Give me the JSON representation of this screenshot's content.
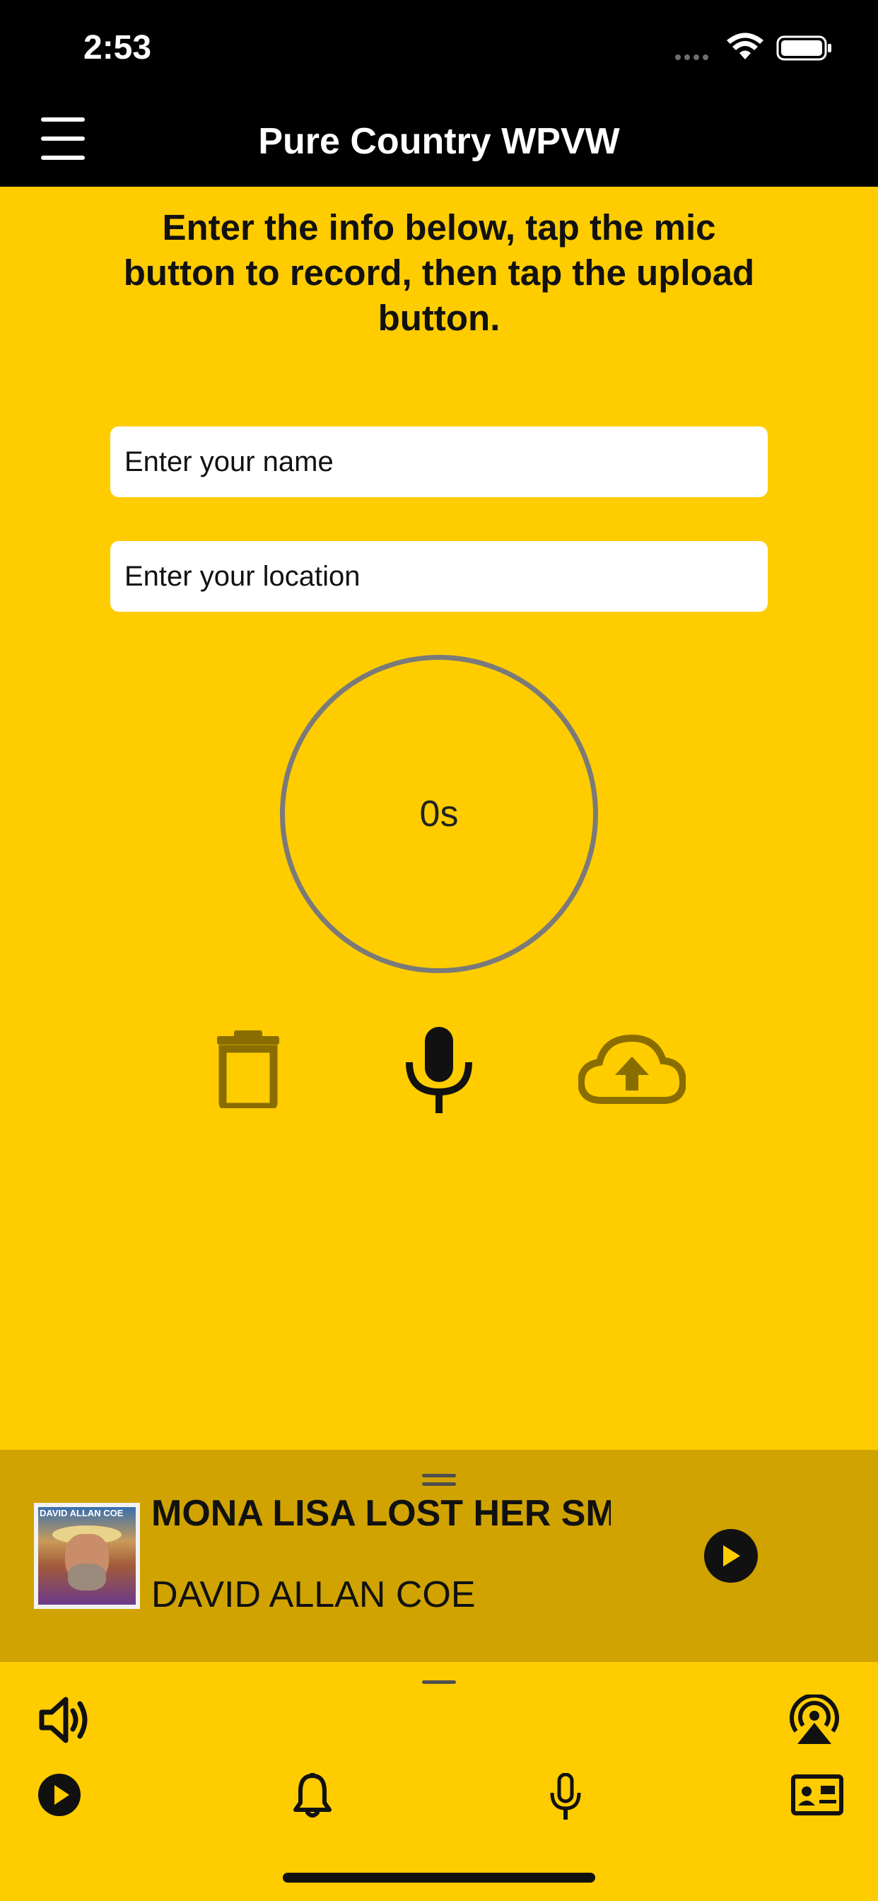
{
  "status_bar": {
    "time": "2:53"
  },
  "nav": {
    "title": "Pure Country WPVW"
  },
  "main": {
    "instructions": "Enter the info below, tap the mic button to record, then tap the upload button.",
    "name_placeholder": "Enter your name",
    "location_placeholder": "Enter your location",
    "timer": "0s"
  },
  "icons": {
    "menu": "hamburger-menu-icon",
    "delete": "trash-icon",
    "record": "microphone-icon",
    "upload": "cloud-upload-icon",
    "volume": "speaker-volume-icon",
    "airplay": "airplay-broadcast-icon",
    "play": "play-circle-icon",
    "notifications": "bell-icon",
    "contact": "contact-card-icon"
  },
  "now_playing": {
    "title": "MONA LISA LOST HER SMILE",
    "artist": "DAVID ALLAN COE",
    "album_art_label": "DAVID ALLAN COE"
  },
  "colors": {
    "background": "#FFCC00",
    "now_playing_bg": "#D0A300",
    "bars": "#000000",
    "disabled_icon": "#8A6D00"
  }
}
